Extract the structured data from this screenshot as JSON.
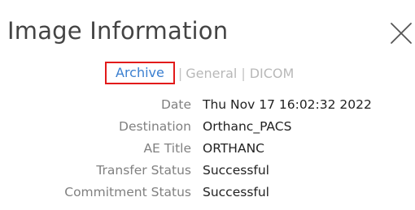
{
  "dialog": {
    "title": "Image Information",
    "close_icon": "close-x-icon"
  },
  "tabs": [
    {
      "label": "Archive",
      "active": true
    },
    {
      "label": "General",
      "active": false
    },
    {
      "label": "DICOM",
      "active": false
    }
  ],
  "tab_separator": "|",
  "info": [
    {
      "label": "Date",
      "value": "Thu Nov 17 16:02:32 2022"
    },
    {
      "label": "Destination",
      "value": "Orthanc_PACS"
    },
    {
      "label": "AE Title",
      "value": "ORTHANC"
    },
    {
      "label": "Transfer Status",
      "value": "Successful"
    },
    {
      "label": "Commitment Status",
      "value": "Successful"
    }
  ],
  "colors": {
    "active_tab_text": "#3a7fd0",
    "active_tab_highlight": "#e21a1a",
    "inactive_tab_text": "#b8b8b8",
    "label_text": "#808080",
    "value_text": "#222222",
    "title_text": "#444444"
  }
}
